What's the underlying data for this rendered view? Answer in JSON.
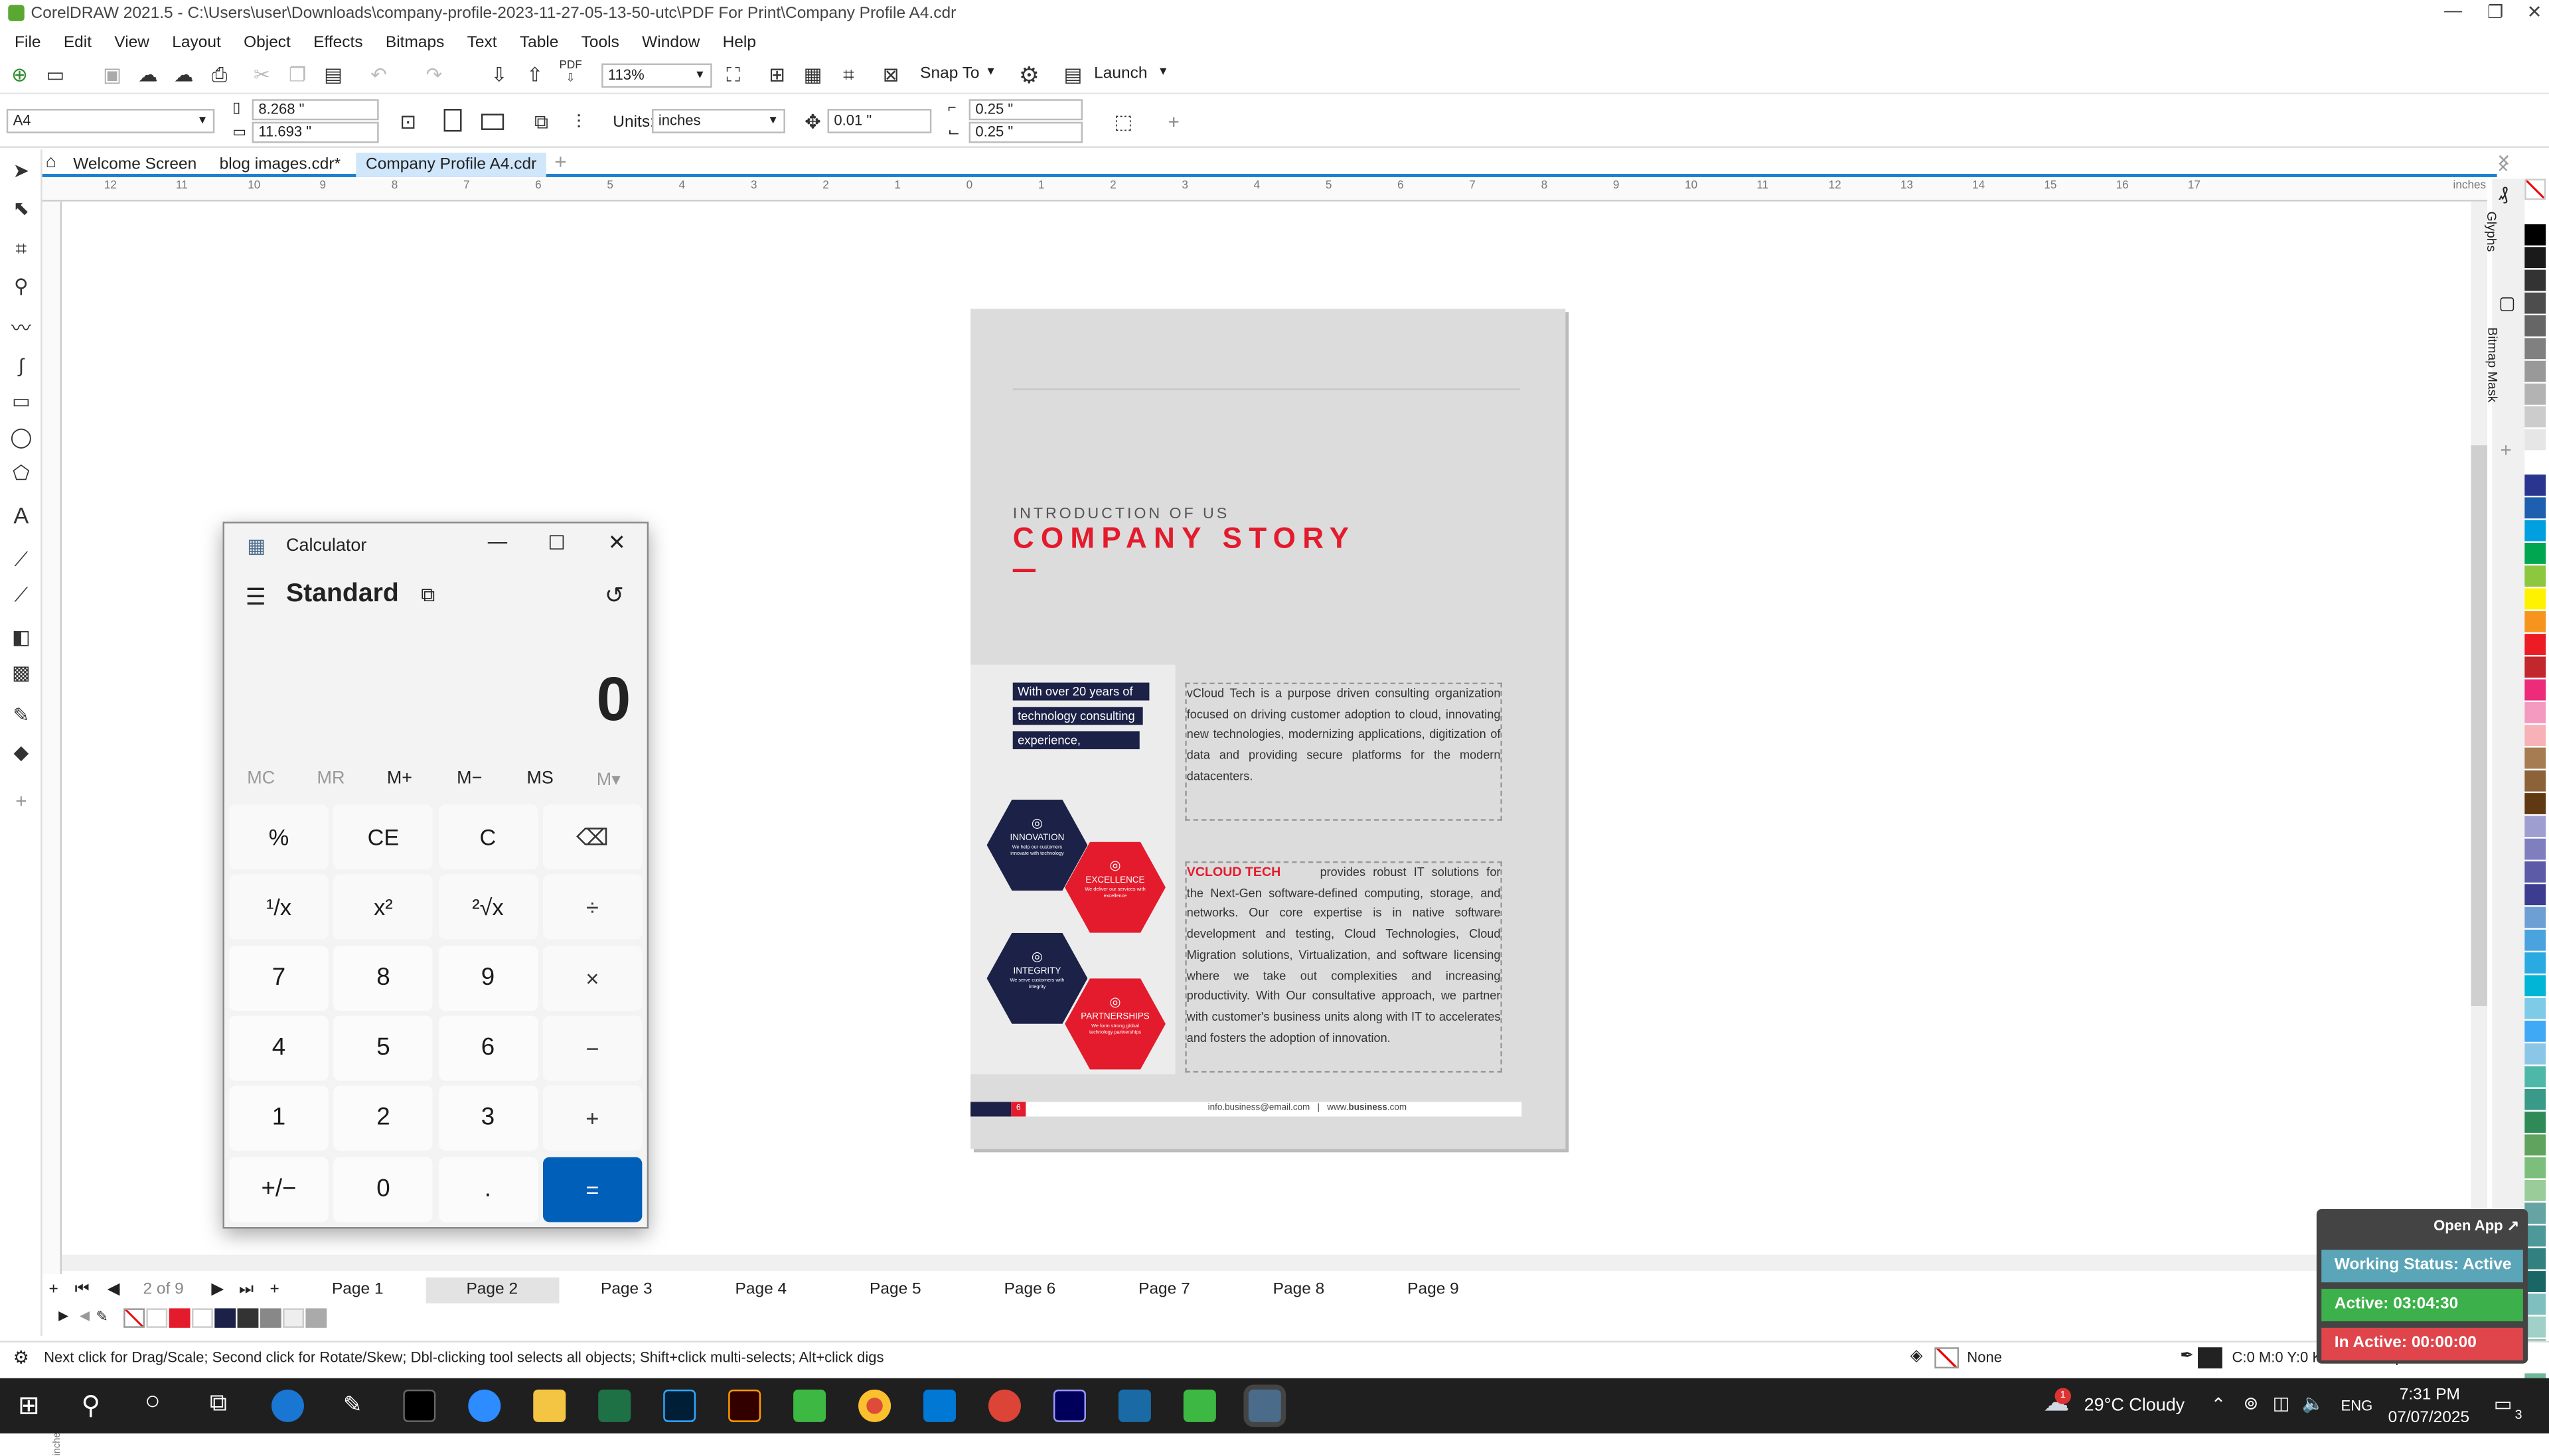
{
  "app": {
    "title": "CorelDRAW 2021.5 - C:\\Users\\user\\Downloads\\company-profile-2023-11-27-05-13-50-utc\\PDF For Print\\Company Profile A4.cdr"
  },
  "menu": [
    "File",
    "Edit",
    "View",
    "Layout",
    "Object",
    "Effects",
    "Bitmaps",
    "Text",
    "Table",
    "Tools",
    "Window",
    "Help"
  ],
  "toolbar": {
    "zoom": "113%",
    "snap_to": "Snap To",
    "launch": "Launch"
  },
  "propbar": {
    "page_size": "A4",
    "width": "8.268 \"",
    "height": "11.693 \"",
    "units_label": "Units:",
    "units": "inches",
    "nudge": "0.01 \"",
    "dup_x": "0.25 \"",
    "dup_y": "0.25 \""
  },
  "tabs": [
    {
      "label": "Welcome Screen"
    },
    {
      "label": "blog images.cdr*"
    },
    {
      "label": "Company Profile A4.cdr"
    }
  ],
  "ruler": {
    "ticks": [
      "12",
      "11",
      "10",
      "9",
      "8",
      "7",
      "6",
      "5",
      "4",
      "3",
      "2",
      "1",
      "0",
      "1",
      "2",
      "3",
      "4",
      "5",
      "6",
      "7",
      "8",
      "9",
      "10",
      "11",
      "12",
      "13",
      "14",
      "15",
      "16",
      "17"
    ],
    "unit": "inches"
  },
  "document": {
    "intro": "INTRODUCTION OF US",
    "title": "COMPANY STORY",
    "highlight": [
      "With over 20 years of",
      "technology consulting",
      "experience,"
    ],
    "para1": "vCloud Tech is a purpose driven consulting organization focused on driving customer adoption to cloud, innovating new technologies, modernizing applications, digitization of data and providing secure platforms for the modern datacenters.",
    "logo": "VCLOUD TECH",
    "para2_lead": "provides robust IT solutions for",
    "para2": "the Next-Gen software-defined computing, storage, and networks. Our core expertise is in native software development and testing, Cloud Technologies, Cloud Migration solutions, Virtualization, and software licensing where we take out complexities and increasing productivity. With Our consultative approach, we partner with customer's business units along with IT to accelerates and fosters the adoption of innovation.",
    "hexes": [
      {
        "label": "INNOVATION",
        "sub": "We help our customers innovate with technology",
        "color": "#1b2147"
      },
      {
        "label": "EXCELLENCE",
        "sub": "We deliver our services with excellence",
        "color": "#e31b2c"
      },
      {
        "label": "INTEGRITY",
        "sub": "We serve customers with integrity",
        "color": "#1b2147"
      },
      {
        "label": "PARTNERSHIPS",
        "sub": "We form strong global technology partnerships",
        "color": "#e31b2c"
      }
    ],
    "footer_page": "6",
    "footer_email": "info.business@email.com",
    "footer_sep": "|",
    "footer_web_pre": "www.",
    "footer_web_bold": "business",
    "footer_web_post": ".com"
  },
  "pagenav": {
    "indicator": "2 of 9",
    "pages": [
      "Page 1",
      "Page 2",
      "Page 3",
      "Page 4",
      "Page 5",
      "Page 6",
      "Page 7",
      "Page 8",
      "Page 9"
    ],
    "active": 1
  },
  "dockers": [
    "Glyphs",
    "Bitmap Mask"
  ],
  "status": {
    "hint": "Next click for Drag/Scale; Second click for Rotate/Skew; Dbl-clicking tool selects all objects; Shift+click multi-selects; Alt+click digs",
    "fill": "None",
    "color": "C:0 M:0 Y:0 K:100 0.500 pt"
  },
  "calculator": {
    "title": "Calculator",
    "mode": "Standard",
    "display": "0",
    "memory": [
      "MC",
      "MR",
      "M+",
      "M−",
      "MS",
      "M▾"
    ],
    "keys": [
      [
        "%",
        "CE",
        "C",
        "⌫"
      ],
      [
        "¹/x",
        "x²",
        "²√x",
        "÷"
      ],
      [
        "7",
        "8",
        "9",
        "×"
      ],
      [
        "4",
        "5",
        "6",
        "−"
      ],
      [
        "1",
        "2",
        "3",
        "+"
      ],
      [
        "+/−",
        "0",
        ".",
        "="
      ]
    ]
  },
  "widget": {
    "open_app": "Open App ↗",
    "status": "Working Status: Active",
    "active": "Active: 03:04:30",
    "inactive": "In Active: 00:00:00"
  },
  "taskbar": {
    "weather": "29°C  Cloudy",
    "lang": "ENG",
    "time": "7:31 PM",
    "date": "07/07/2025",
    "notif": "3",
    "weather_badge": "1"
  },
  "colors": {
    "accent": "#1d7fd0",
    "brand_red": "#e31b2c",
    "brand_navy": "#1b2147",
    "calc_eq": "#005fb8"
  },
  "palette": [
    "#ffffff",
    "#000000",
    "#1a1a1a",
    "#333333",
    "#4d4d4d",
    "#666666",
    "#808080",
    "#999999",
    "#b3b3b3",
    "#cccccc",
    "#e6e6e6",
    "#ffffff",
    "#2a3590",
    "#1e5fb0",
    "#00a0e0",
    "#00a650",
    "#8dc63f",
    "#fff200",
    "#f7941d",
    "#ed1c24",
    "#c1272d",
    "#ee2a7b",
    "#f49ac1",
    "#f7b2b7",
    "#a67c52",
    "#8c6239",
    "#603913",
    "#9e9ed1",
    "#7f7fbf",
    "#5b5ba8",
    "#3c3c90",
    "#6d9fd4",
    "#4aa3df",
    "#29abe2",
    "#00b5d6",
    "#7ecbe8",
    "#3fa9f5",
    "#8cc6e7",
    "#4db8a8",
    "#3a9a8a",
    "#2e8b57",
    "#5fa35f",
    "#7cbf7c",
    "#99cc99",
    "#66a3a3",
    "#4d9999",
    "#338080",
    "#1a6666",
    "#80bfbf",
    "#a0d0c8",
    "#88c4a8",
    "#6fb89a"
  ]
}
